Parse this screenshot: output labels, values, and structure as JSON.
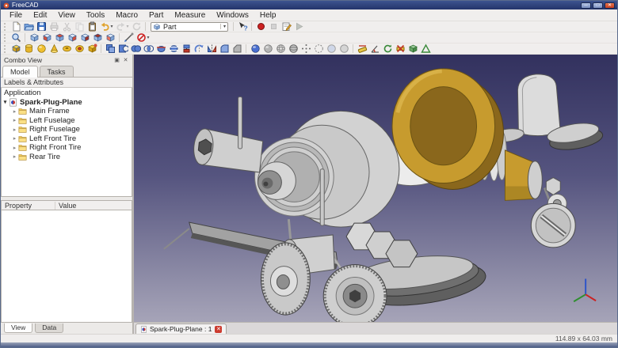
{
  "window": {
    "title": "FreeCAD",
    "controls": {
      "minimize": "minimize",
      "maximize": "maximize",
      "close": "close"
    }
  },
  "menu": {
    "items": [
      "File",
      "Edit",
      "View",
      "Tools",
      "Macro",
      "Part",
      "Measure",
      "Windows",
      "Help"
    ]
  },
  "toolbars": {
    "file": {
      "items": [
        {
          "name": "new"
        },
        {
          "name": "open"
        },
        {
          "name": "save"
        },
        {
          "name": "print",
          "disabled": true
        },
        {
          "name": "cut",
          "disabled": true
        },
        {
          "name": "copy",
          "disabled": true
        },
        {
          "name": "paste"
        },
        {
          "name": "undo",
          "dropdown": true
        },
        {
          "name": "redo",
          "disabled": true,
          "dropdown": true
        },
        {
          "name": "refresh",
          "disabled": true
        }
      ]
    },
    "workbench": {
      "selected": "Part"
    },
    "macro": {
      "items": [
        {
          "name": "whats-this"
        },
        {
          "sep": true
        },
        {
          "name": "macro-record"
        },
        {
          "name": "macro-stop",
          "disabled": true
        },
        {
          "name": "macro-edit"
        },
        {
          "name": "macro-execute",
          "disabled": true
        }
      ]
    },
    "view": {
      "items": [
        {
          "name": "fit-all"
        },
        {
          "sep": true
        },
        {
          "name": "view-axonometric"
        },
        {
          "name": "view-front"
        },
        {
          "name": "view-top"
        },
        {
          "name": "view-right"
        },
        {
          "name": "view-rear"
        },
        {
          "name": "view-bottom"
        },
        {
          "name": "view-left"
        },
        {
          "sep": true
        },
        {
          "name": "measure-distance"
        },
        {
          "name": "clear-measurement",
          "dropdown": true
        }
      ]
    },
    "part": {
      "items": [
        {
          "name": "box"
        },
        {
          "name": "cylinder"
        },
        {
          "name": "sphere"
        },
        {
          "name": "cone"
        },
        {
          "name": "torus"
        },
        {
          "name": "tube"
        },
        {
          "name": "shape-builder"
        },
        {
          "sep": true
        },
        {
          "name": "boolean"
        },
        {
          "name": "part-cut"
        },
        {
          "name": "union"
        },
        {
          "name": "common"
        },
        {
          "name": "section"
        },
        {
          "name": "cross-section"
        },
        {
          "name": "extrude"
        },
        {
          "name": "revolve"
        },
        {
          "name": "mirror"
        },
        {
          "name": "fillet"
        },
        {
          "name": "chamfer"
        },
        {
          "sep": true
        },
        {
          "name": "appearance"
        },
        {
          "name": "shaded"
        },
        {
          "name": "wireframe"
        },
        {
          "name": "flat-lines"
        },
        {
          "name": "points"
        },
        {
          "name": "hidden-line"
        },
        {
          "name": "transparency"
        },
        {
          "name": "no-shading"
        },
        {
          "sep": true
        },
        {
          "name": "measure-linear"
        },
        {
          "name": "measure-angular"
        },
        {
          "name": "measure-refresh"
        },
        {
          "name": "measure-clear"
        },
        {
          "name": "toggle-3d"
        },
        {
          "name": "toggle-delta"
        }
      ]
    }
  },
  "combo_view": {
    "title": "Combo View",
    "tabs": [
      {
        "label": "Model",
        "active": true
      },
      {
        "label": "Tasks",
        "active": false
      }
    ],
    "tree_header": "Labels & Attributes",
    "tree": {
      "root": "Application",
      "document_label": "Spark-Plug-Plane",
      "children": [
        "Main Frame",
        "Left Fuselage",
        "Right Fuselage",
        "Left Front Tire",
        "Right Front Tire",
        "Rear Tire"
      ]
    },
    "property_panel": {
      "columns": [
        "Property",
        "Value"
      ],
      "rows": [],
      "tabs": [
        {
          "label": "View"
        },
        {
          "label": "Data"
        }
      ]
    }
  },
  "viewport": {
    "colors": {
      "background_top": "#32315e",
      "background_mid": "#55547f",
      "background_bottom": "#a6a4b8",
      "silver": "#d2d2d2",
      "silver_light": "#ececec",
      "silver_dark": "#9a9a9a",
      "gold": "#c79b2e",
      "gold_dark": "#8a671c",
      "wing_gray": "#6f6f6f",
      "axis_x": "#cc2222",
      "axis_y": "#2e8f2e",
      "axis_z": "#2f55c8"
    }
  },
  "mdi": {
    "tab_label": "Spark-Plug-Plane : 1"
  },
  "statusbar": {
    "dimensions": "114.89 x 64.03 mm"
  }
}
